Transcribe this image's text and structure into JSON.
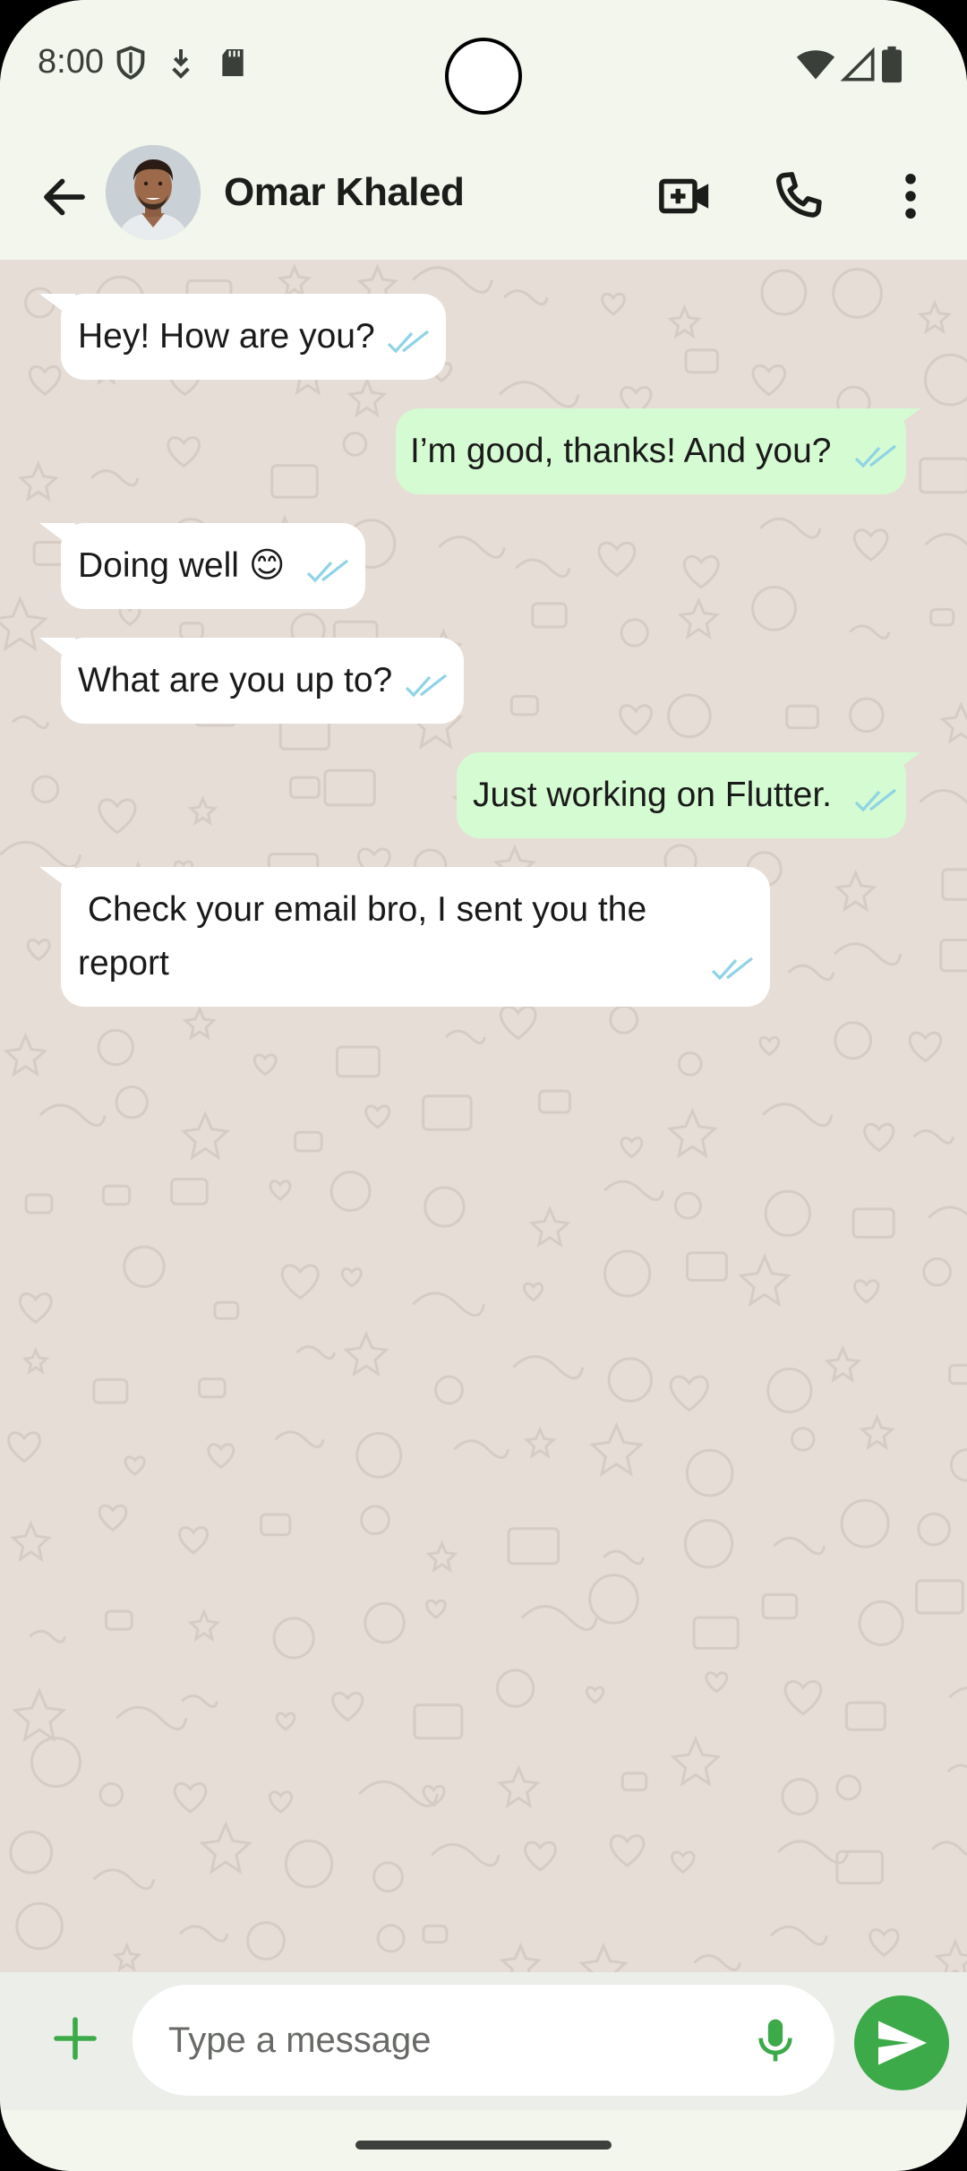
{
  "status_bar": {
    "time": "8:00"
  },
  "header": {
    "contact_name": "Omar Khaled",
    "icons": [
      "back-arrow-icon",
      "video-call-icon",
      "phone-icon",
      "more-vert-icon"
    ]
  },
  "messages": [
    {
      "direction": "incoming",
      "text": "Hey! How are you?",
      "status": "read"
    },
    {
      "direction": "outgoing",
      "text": "I’m good, thanks! And you?",
      "status": "read"
    },
    {
      "direction": "incoming",
      "text": "Doing well 😊",
      "status": "read"
    },
    {
      "direction": "incoming",
      "text": "What are you up to?",
      "status": "read"
    },
    {
      "direction": "outgoing",
      "text": "Just working on Flutter.",
      "status": "read"
    },
    {
      "direction": "incoming",
      "text_line1": " Check your email bro, I sent you the",
      "text_line2": "report",
      "status": "read"
    }
  ],
  "composer": {
    "placeholder": "Type a message"
  },
  "colors": {
    "incoming_bubble": "#ffffff",
    "outgoing_bubble": "#d5fbd2",
    "chat_background": "#e6ddd6",
    "accent": "#3daa49",
    "read_ticks": "#8fd3e6"
  }
}
